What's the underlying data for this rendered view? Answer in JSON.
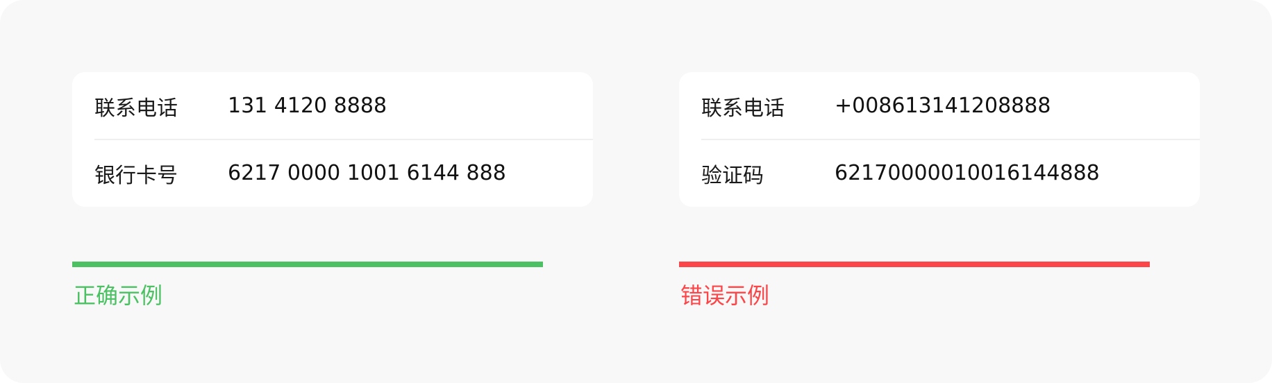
{
  "colors": {
    "correct": "#4cc163",
    "wrong": "#fb4548"
  },
  "correct_example": {
    "rows": [
      {
        "label": "联系电话",
        "value": "131 4120 8888"
      },
      {
        "label": "银行卡号",
        "value": "6217 0000 1001 6144 888"
      }
    ],
    "caption": "正确示例"
  },
  "wrong_example": {
    "rows": [
      {
        "label": "联系电话",
        "value": "+008613141208888"
      },
      {
        "label": "验证码",
        "value": "62170000010016144888"
      }
    ],
    "caption": "错误示例"
  }
}
